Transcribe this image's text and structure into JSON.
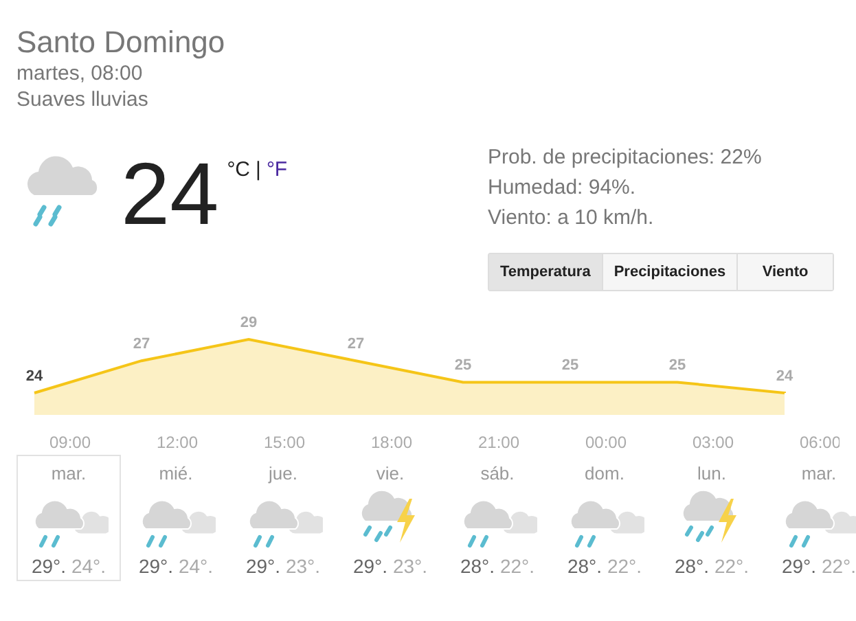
{
  "location": "Santo Domingo",
  "datetime": "martes, 08:00",
  "condition": "Suaves lluvias",
  "current": {
    "kind": "rain",
    "temperature": "24",
    "units": [
      {
        "label": "°C",
        "selected": true
      },
      {
        "label": "°F",
        "selected": false
      }
    ],
    "separator": "|"
  },
  "details": [
    "Prob. de precipitaciones: 22%",
    "Humedad: 94%.",
    "Viento: a 10 km/h."
  ],
  "tabs": [
    {
      "label": "Temperatura",
      "selected": true
    },
    {
      "label": "Precipitaciones",
      "selected": false
    },
    {
      "label": "Viento",
      "selected": false
    }
  ],
  "chart": {
    "chart_data": {
      "type": "area",
      "categories": [
        null,
        null,
        null,
        null,
        null,
        null,
        null,
        null
      ],
      "series": [
        {
          "color": "#f5c518",
          "values": [
            24,
            27,
            29,
            27,
            25,
            25,
            25,
            24
          ]
        }
      ],
      "data_labels": true
    },
    "time_labels": [
      "09:00",
      "12:00",
      "15:00",
      "18:00",
      "21:00",
      "00:00",
      "03:00",
      "06:00"
    ]
  },
  "days": [
    {
      "day": "mar.",
      "kind": "rain",
      "high": "29°.",
      "low": "24°.",
      "selected": true
    },
    {
      "day": "mié.",
      "kind": "rain",
      "high": "29°.",
      "low": "24°.",
      "selected": false
    },
    {
      "day": "jue.",
      "kind": "rain",
      "high": "29°.",
      "low": "23°.",
      "selected": false
    },
    {
      "day": "vie.",
      "kind": "storm",
      "high": "29°.",
      "low": "23°.",
      "selected": false
    },
    {
      "day": "sáb.",
      "kind": "rain",
      "high": "28°.",
      "low": "22°.",
      "selected": false
    },
    {
      "day": "dom.",
      "kind": "rain",
      "high": "28°.",
      "low": "22°.",
      "selected": false
    },
    {
      "day": "lun.",
      "kind": "storm",
      "high": "28°.",
      "low": "22°.",
      "selected": false
    },
    {
      "day": "mar.",
      "kind": "rain",
      "high": "29°.",
      "low": "22°.",
      "selected": false
    }
  ]
}
